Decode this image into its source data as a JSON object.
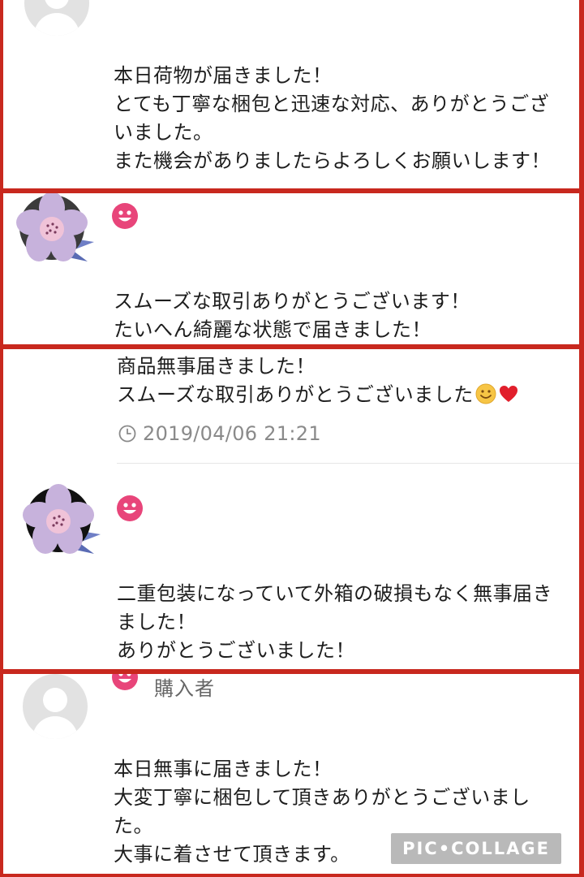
{
  "reviews": [
    {
      "avatar": "default-avatar-icon",
      "lines": [
        "本日荷物が届きました！",
        "とても丁寧な梱包と迅速な対応、ありがとうござ",
        "いました。",
        "また機会がありましたらよろしくお願いします！"
      ]
    },
    {
      "avatar": "flower-avatar-icon",
      "rating": "smiley-good-icon",
      "lines": [
        "スムーズな取引ありがとうございます！",
        "たいへん綺麗な状態で届きました！"
      ]
    },
    {
      "lines": [
        "商品無事届きました！",
        "スムーズな取引ありがとうございました"
      ],
      "timestamp": "2019/04/06 21:21"
    },
    {
      "avatar": "flower-avatar-icon",
      "rating": "smiley-good-icon",
      "lines": [
        "二重包装になっていて外箱の破損もなく無事届き",
        "ました！",
        "ありがとうございました！"
      ]
    },
    {
      "avatar": "default-avatar-icon",
      "rating": "smiley-good-icon",
      "role": "購入者",
      "lines": [
        "本日無事に届きました！",
        "大変丁寧に梱包して頂きありがとうございまし",
        "た。",
        "大事に着させて頂きます。"
      ]
    }
  ],
  "watermark": "PIC•COLLAGE",
  "colors": {
    "border": "#c8281e",
    "smiley": "#e8457a",
    "timestamp": "#8a8a8a"
  }
}
